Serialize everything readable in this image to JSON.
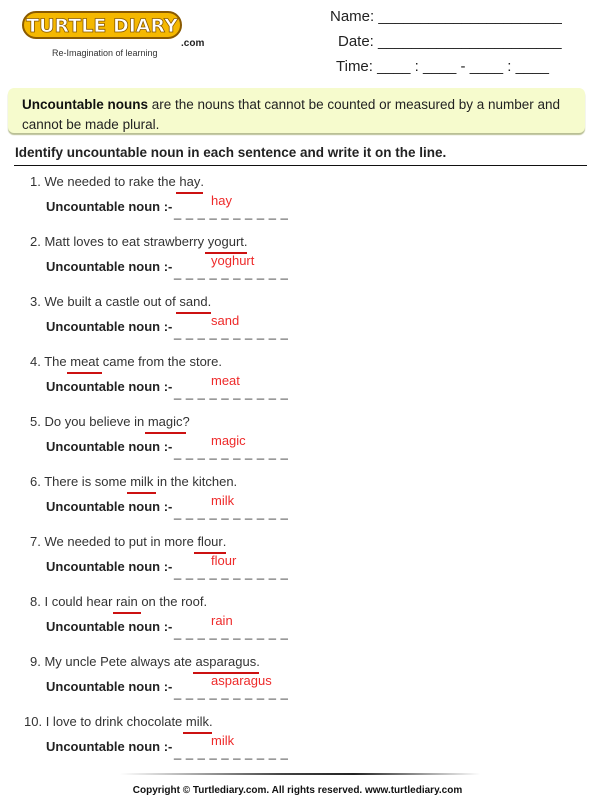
{
  "brand": {
    "logo_text": "TURTLE DIARY",
    "domain_suffix": ".com",
    "tagline": "Re-Imagination of learning",
    "logo_fill": "#f5b800",
    "logo_outline": "#8a5a00"
  },
  "header_fields": {
    "name_label": "Name:",
    "name_blank": "______________________",
    "date_label": "Date:",
    "date_blank": "______________________",
    "time_label": "Time:",
    "time_blank": "____ : ____ - ____ : ____"
  },
  "definition": {
    "term": "Uncountable nouns",
    "text": " are the nouns that cannot be counted or measured by a number and cannot be made plural.",
    "background": "#f6fbcd"
  },
  "instruction": "Identify uncountable noun in each sentence and write it on the line.",
  "answer_label": "Uncountable noun :-",
  "dashes": "__________",
  "answer_color": "#ee2a2a",
  "underline_color": "#cc1111",
  "questions": [
    {
      "number": "1.",
      "before": "We needed to rake the ",
      "noun": "hay",
      "after": ".",
      "answer": "hay"
    },
    {
      "number": "2.",
      "before": "Matt loves to eat strawberry ",
      "noun": "yogurt",
      "after": ".",
      "answer": "yoghurt"
    },
    {
      "number": "3.",
      "before": "We built a castle out of ",
      "noun": "sand",
      "after": ".",
      "answer": "sand"
    },
    {
      "number": "4.",
      "before": "The ",
      "noun": "meat",
      "after": " came from the store.",
      "answer": "meat"
    },
    {
      "number": "5.",
      "before": "Do you believe in ",
      "noun": "magic",
      "after": "?",
      "answer": "magic"
    },
    {
      "number": "6.",
      "before": "There is some ",
      "noun": "milk",
      "after": " in the kitchen.",
      "answer": "milk"
    },
    {
      "number": "7.",
      "before": "We needed to put in more ",
      "noun": "flour",
      "after": ".",
      "answer": "flour"
    },
    {
      "number": "8.",
      "before": "I could hear ",
      "noun": "rain",
      "after": " on the roof.",
      "answer": "rain"
    },
    {
      "number": "9.",
      "before": "My uncle Pete always ate ",
      "noun": "asparagus",
      "after": ".",
      "answer": "asparagus"
    },
    {
      "number": "10.",
      "before": "I love to drink chocolate ",
      "noun": "milk",
      "after": ".",
      "answer": "milk"
    }
  ],
  "footer": {
    "copyright": "Copyright © Turtlediary.com. All rights reserved. www.turtlediary.com"
  }
}
